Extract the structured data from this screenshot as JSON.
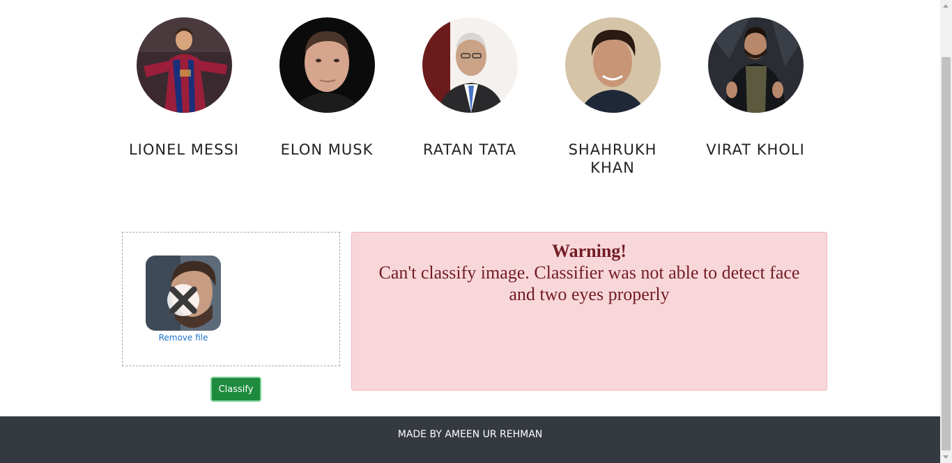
{
  "celebrities": [
    {
      "name": "LIONEL MESSI",
      "photo_icon": "lionel-messi-photo"
    },
    {
      "name": "ELON MUSK",
      "photo_icon": "elon-musk-photo"
    },
    {
      "name": "RATAN TATA",
      "photo_icon": "ratan-tata-photo"
    },
    {
      "name": "SHAHRUKH KHAN",
      "photo_icon": "shahrukh-khan-photo"
    },
    {
      "name": "VIRAT KHOLI",
      "photo_icon": "virat-kholi-photo"
    }
  ],
  "upload": {
    "remove_label": "Remove file",
    "remove_icon": "close-icon",
    "thumbnail_icon": "uploaded-image-thumbnail"
  },
  "classify_button": "Classify",
  "alert": {
    "title": "Warning!",
    "message": "Can't classify image. Classifier was not able to detect face and two eyes properly"
  },
  "footer": {
    "text": "MADE BY AMEEN UR REHMAN"
  },
  "colors": {
    "alert_bg": "#f8d7da",
    "alert_text": "#721c24",
    "button_bg": "#1e8a3e",
    "footer_bg": "#343a40",
    "link": "#1a73c8"
  }
}
